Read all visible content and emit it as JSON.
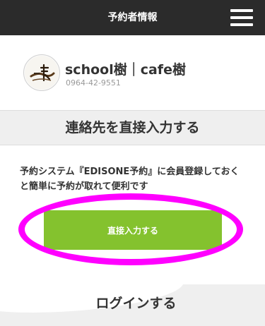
{
  "header": {
    "title": "予約者情報",
    "menu_icon": "hamburger-menu-icon"
  },
  "shop": {
    "logo_icon": "shop-logo-icon",
    "name": "school樹｜cafe樹",
    "phone": "0964-42-9551"
  },
  "direct_entry": {
    "section_title": "連絡先を直接入力する",
    "description": "予約システム『EDISONE予約』に会員登録しておくと簡単に予約が取れて便利です",
    "button_label": "直接入力する"
  },
  "login": {
    "section_title": "ログインする"
  },
  "colors": {
    "header_bg": "#2b2b2b",
    "button_bg": "#84c22e",
    "highlight": "#ff00ff",
    "section_bg": "#efefef"
  }
}
